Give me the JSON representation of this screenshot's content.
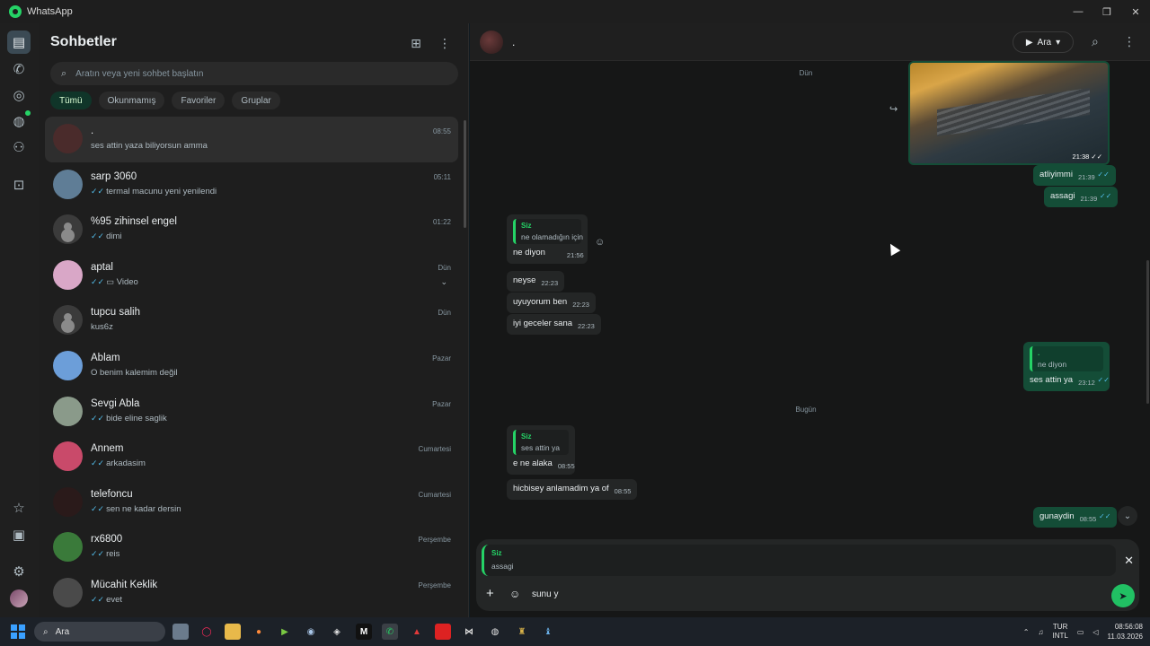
{
  "window": {
    "title": "WhatsApp",
    "controls": [
      "—",
      "❐",
      "✕"
    ]
  },
  "rail": {
    "icons": [
      "chats-icon",
      "calls-icon",
      "status-icon",
      "channels-icon",
      "communities-icon",
      "archive-icon",
      "starred-icon",
      "media-icon",
      "settings-icon"
    ]
  },
  "chatlist": {
    "title": "Sohbetler",
    "search_placeholder": "Aratın veya yeni sohbet başlatın",
    "filters": [
      "Tümü",
      "Okunmamış",
      "Favoriler",
      "Gruplar"
    ],
    "active_filter": "Tümü",
    "chats": [
      {
        "name": ".",
        "preview": "ses attin yaza biliyorsun amma",
        "time": "08:55",
        "ticks": false,
        "avatar": "#4a2b2b",
        "selected": true
      },
      {
        "name": "sarp 3060",
        "preview": "termal macunu yeni yenilendi",
        "time": "05:11",
        "ticks": true,
        "avatar": "#5f7d96"
      },
      {
        "name": "%95 zihinsel engel",
        "preview": "dimi",
        "time": "01:22",
        "ticks": true,
        "avatar": "placeholder"
      },
      {
        "name": "aptal",
        "preview": "Video",
        "time": "Dün",
        "ticks": true,
        "video": true,
        "chevron": true,
        "avatar": "#d9a7c7"
      },
      {
        "name": "tupcu salih",
        "preview": "kus6z",
        "time": "Dün",
        "ticks": false,
        "avatar": "placeholder"
      },
      {
        "name": "Ablam",
        "preview": "O benim kalemim değil",
        "time": "Pazar",
        "ticks": false,
        "avatar": "#6c9ed9"
      },
      {
        "name": "Sevgi Abla",
        "preview": "bide eline saglik",
        "time": "Pazar",
        "ticks": true,
        "avatar": "#8a9a8a"
      },
      {
        "name": "Annem",
        "preview": "arkadasim",
        "time": "Cumartesi",
        "ticks": true,
        "avatar": "#c94a6a"
      },
      {
        "name": "telefoncu",
        "preview": "sen ne kadar dersin",
        "time": "Cumartesi",
        "ticks": true,
        "avatar": "#2a1a1a"
      },
      {
        "name": "rx6800",
        "preview": "reis",
        "time": "Perşembe",
        "ticks": true,
        "avatar": "#3a7a3a"
      },
      {
        "name": "Mücahit Keklik",
        "preview": "evet",
        "time": "Perşembe",
        "ticks": true,
        "avatar": "#4a4a4a"
      }
    ]
  },
  "conversation": {
    "contact_name": ".",
    "call_label": "Ara",
    "days": {
      "yesterday": "Dün",
      "today": "Bugün"
    },
    "messages": {
      "image_time": "21:38",
      "m1": {
        "text": "atliyimmi",
        "time": "21:39"
      },
      "m2": {
        "text": "assagi",
        "time": "21:39"
      },
      "m3": {
        "quote_name": "Siz",
        "quote_text": "ne olamadığın için",
        "text": "ne diyon",
        "time": "21:56"
      },
      "m4": {
        "text": "neyse",
        "time": "22:23"
      },
      "m5": {
        "text": "uyuyorum ben",
        "time": "22:23"
      },
      "m6": {
        "text": "iyi geceler sana",
        "time": "22:23"
      },
      "m7": {
        "quote_name": ".",
        "quote_text": "ne diyon",
        "text": "ses attin ya",
        "time": "23:12"
      },
      "m8": {
        "quote_name": "Siz",
        "quote_text": "ses attin ya",
        "text": "e ne alaka",
        "time": "08:55"
      },
      "m9": {
        "text": "hicbisey anlamadim ya of",
        "time": "08:55"
      },
      "m10": {
        "text": "gunaydin",
        "time": "08:55"
      }
    },
    "composer": {
      "reply_name": "Siz",
      "reply_text": "assagi",
      "input_value": "sunu y"
    }
  },
  "taskbar": {
    "search_label": "Ara",
    "lang_top": "TUR",
    "lang_bottom": "INTL",
    "time": "08:56:08",
    "date": "11.03.2026"
  }
}
